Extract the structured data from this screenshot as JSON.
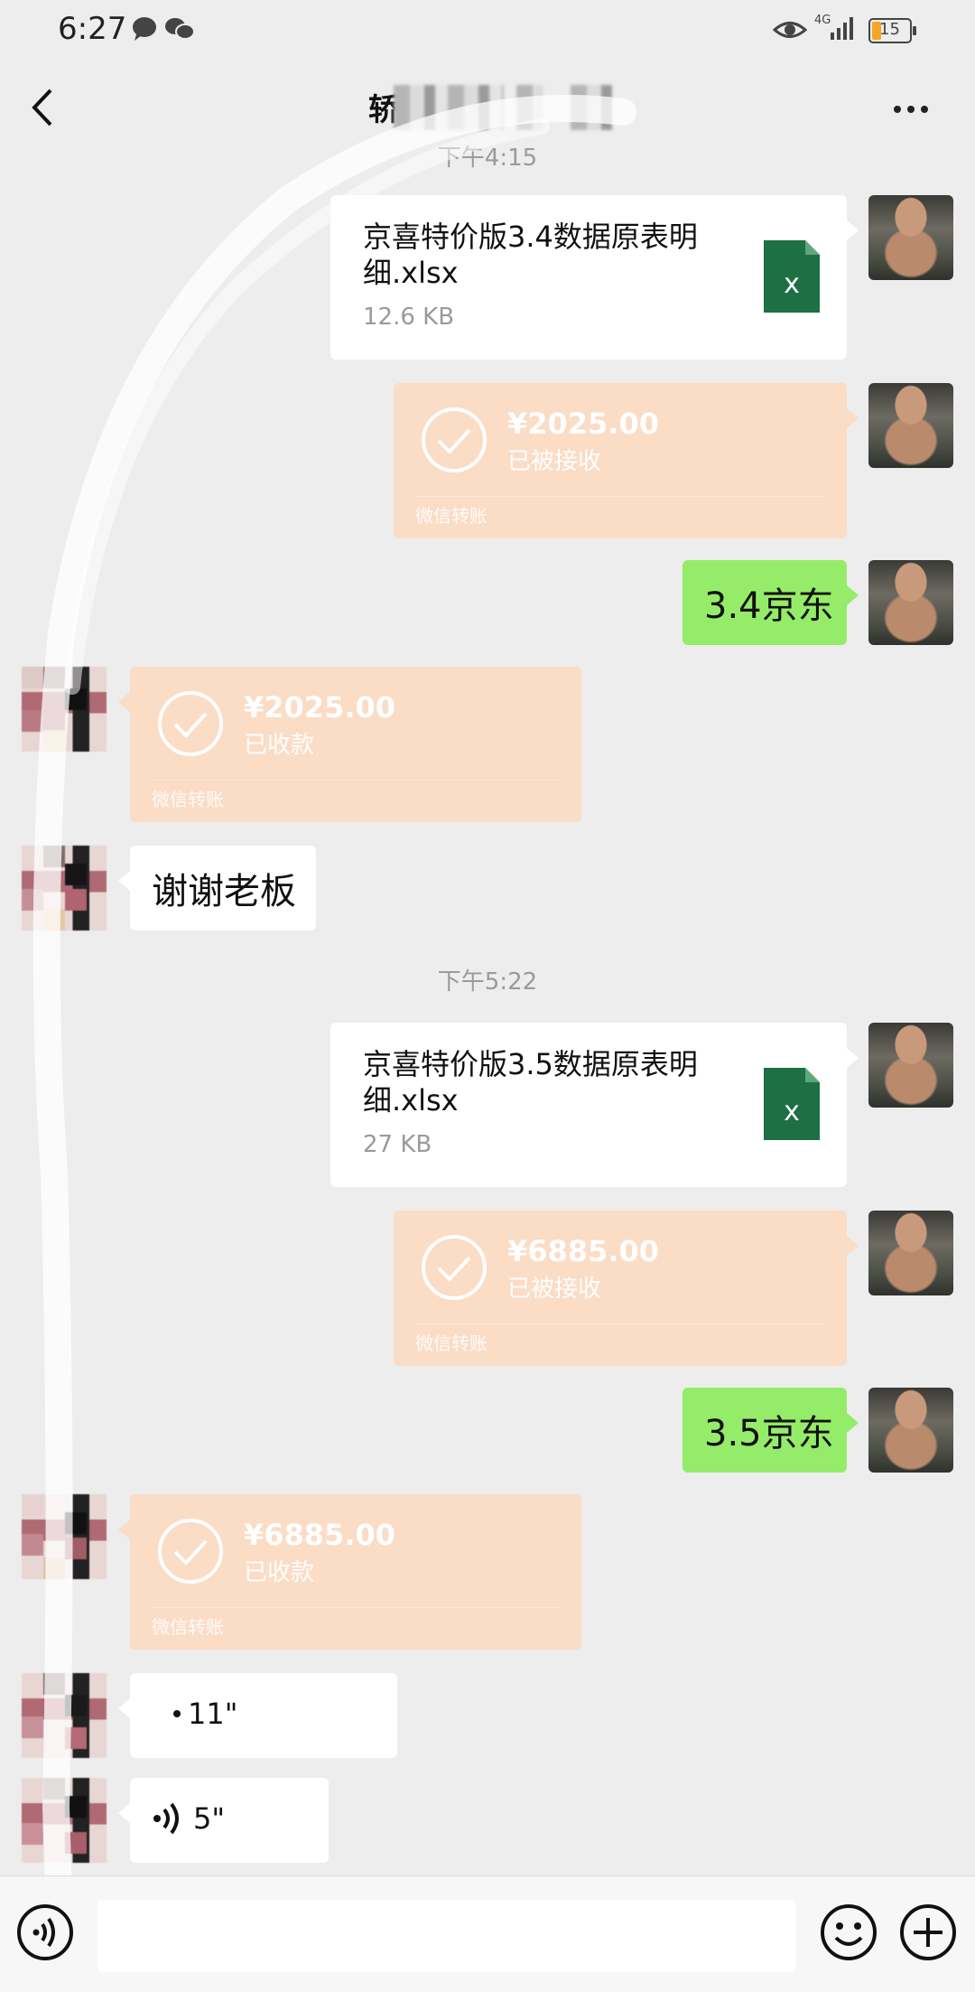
{
  "status_bar": {
    "time": "6:27",
    "network": "4G",
    "battery": "15"
  },
  "header": {
    "title_visible": "轿"
  },
  "messages": {
    "ts_top": "下午4:15",
    "file1": {
      "name": "京喜特价版3.4数据原表明细.xlsx",
      "size": "12.6 KB"
    },
    "transfer1_sent": {
      "amount": "¥2025.00",
      "status": "已被接收",
      "footer": "微信转账"
    },
    "text1": "3.4京东",
    "transfer1_recv": {
      "amount": "¥2025.00",
      "status": "已收款",
      "footer": "微信转账"
    },
    "text2": "谢谢老板",
    "ts_mid": "下午5:22",
    "file2": {
      "name": "京喜特价版3.5数据原表明细.xlsx",
      "size": "27 KB"
    },
    "transfer2_sent": {
      "amount": "¥6885.00",
      "status": "已被接收",
      "footer": "微信转账"
    },
    "text3": "3.5京东",
    "transfer2_recv": {
      "amount": "¥6885.00",
      "status": "已收款",
      "footer": "微信转账"
    },
    "voice1": "11\"",
    "voice2": "5\""
  },
  "colors": {
    "background": "#ededed",
    "green_bubble": "#95ec69",
    "transfer_bubble": "#fbdcc5",
    "excel_green": "#1d7044"
  }
}
